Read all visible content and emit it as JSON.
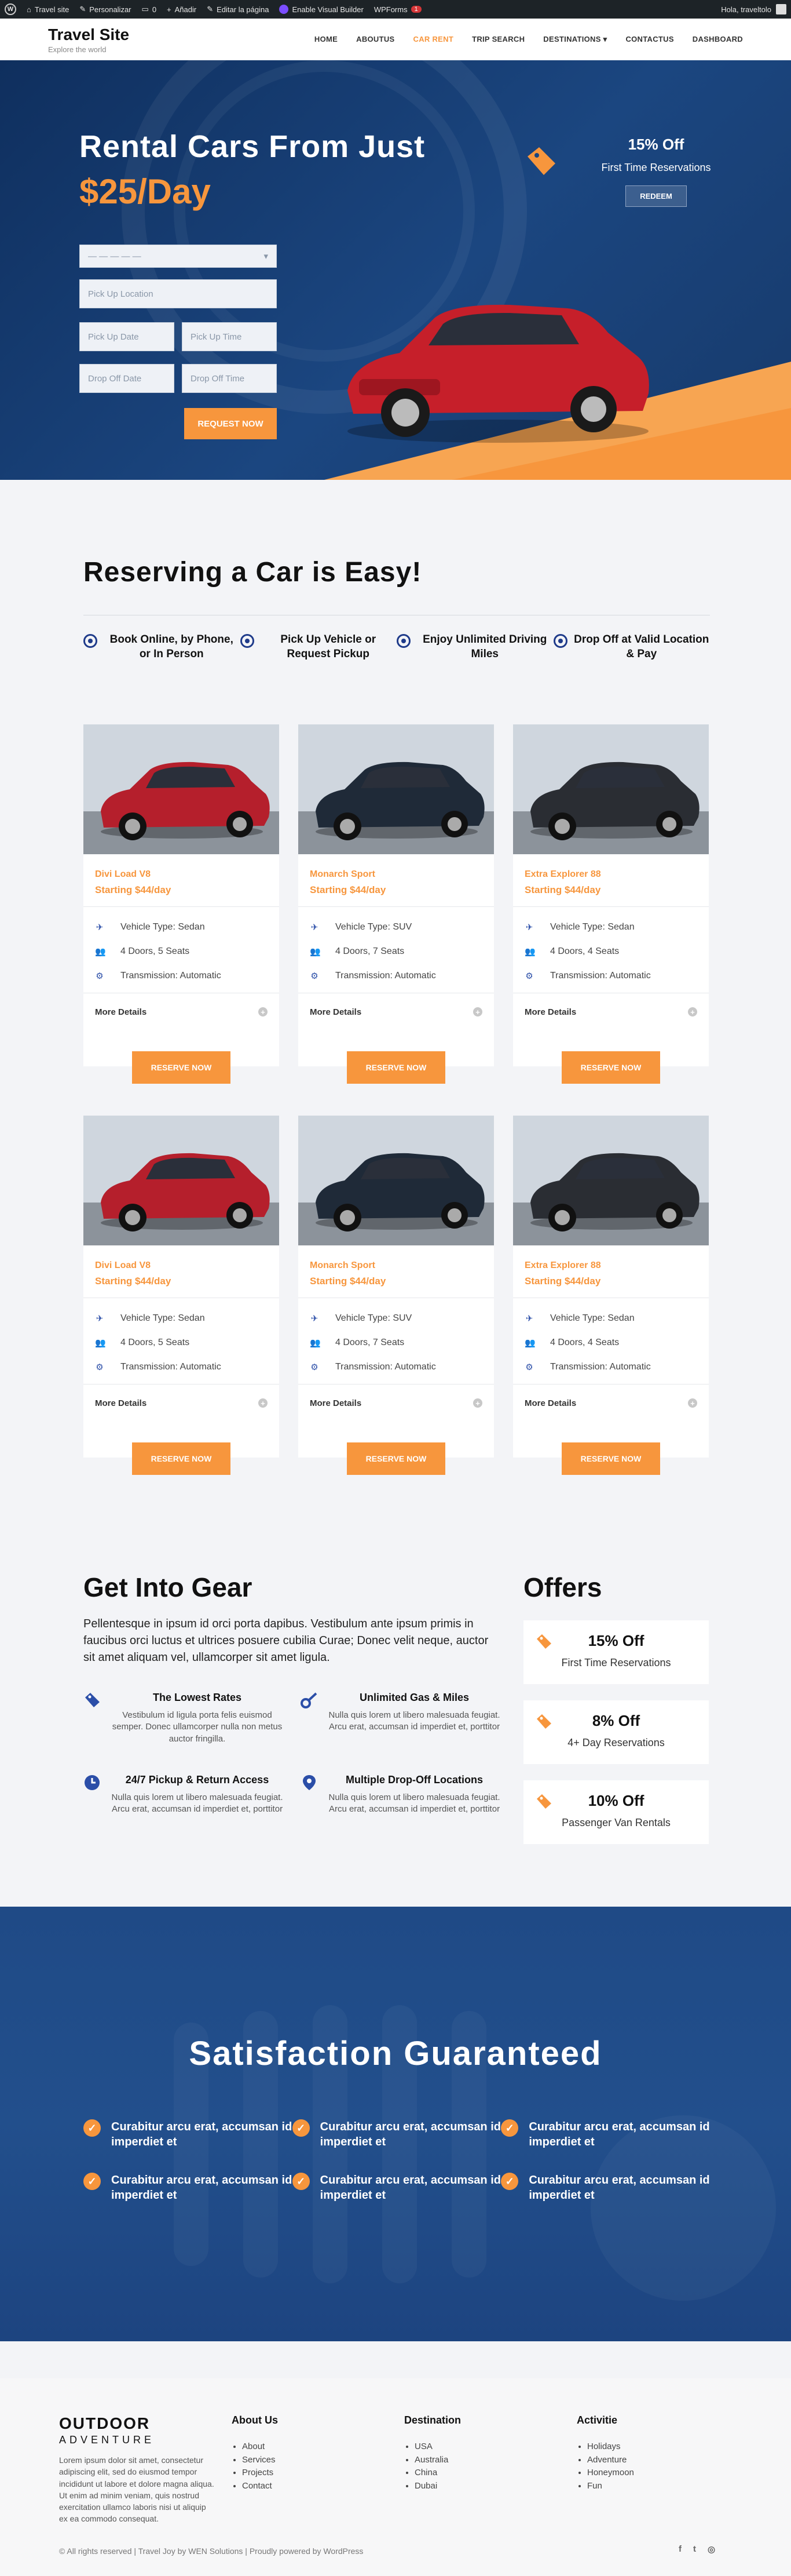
{
  "adminbar": {
    "items": [
      "Travel site",
      "Personalizar",
      "0",
      "Añadir",
      "Editar la página",
      "Enable Visual Builder",
      "WPForms",
      "1"
    ],
    "greeting": "Hola, traveltolo"
  },
  "header": {
    "site_title": "Travel Site",
    "tagline": "Explore the world",
    "nav": [
      "HOME",
      "ABOUTUS",
      "CAR RENT",
      "TRIP SEARCH",
      "DESTINATIONS",
      "CONTACTUS",
      "DASHBOARD"
    ],
    "active_nav": "CAR RENT"
  },
  "hero": {
    "title": "Rental Cars From Just",
    "price": "$25/Day",
    "select_placeholder": "— — — — —",
    "pickup_location": "Pick Up Location",
    "pickup_date": "Pick Up Date",
    "pickup_time": "Pick Up Time",
    "dropoff_date": "Drop Off Date",
    "dropoff_time": "Drop Off Time",
    "request_button": "REQUEST NOW",
    "offer_percent": "15% Off",
    "offer_text": "First Time Reservations",
    "redeem_button": "REDEEM"
  },
  "steps": {
    "title": "Reserving a Car is Easy!",
    "items": [
      "Book Online, by Phone, or In Person",
      "Pick Up Vehicle or Request Pickup",
      "Enjoy Unlimited Driving Miles",
      "Drop Off at Valid Location & Pay"
    ]
  },
  "cars": [
    {
      "name": "Divi Load V8",
      "price": "Starting $44/day",
      "type": "Vehicle Type: Sedan",
      "doors": "4 Doors, 5 Seats",
      "trans": "Transmission: Automatic",
      "color": "#b51f2c"
    },
    {
      "name": "Monarch Sport",
      "price": "Starting $44/day",
      "type": "Vehicle Type: SUV",
      "doors": "4 Doors, 7 Seats",
      "trans": "Transmission: Automatic",
      "color": "#1f2a38"
    },
    {
      "name": "Extra Explorer 88",
      "price": "Starting $44/day",
      "type": "Vehicle Type: Sedan",
      "doors": "4 Doors, 4 Seats",
      "trans": "Transmission: Automatic",
      "color": "#2a2d33"
    }
  ],
  "car_common": {
    "more_details": "More Details",
    "reserve": "RESERVE NOW"
  },
  "gear": {
    "title": "Get Into Gear",
    "lead": "Pellentesque in ipsum id orci porta dapibus. Vestibulum ante ipsum primis in faucibus orci luctus et ultrices posuere cubilia Curae; Donec velit neque, auctor sit amet aliquam vel, ullamcorper sit amet ligula.",
    "features": [
      {
        "title": "The Lowest Rates",
        "text": "Vestibulum id ligula porta felis euismod semper. Donec ullamcorper nulla non metus auctor fringilla."
      },
      {
        "title": "Unlimited Gas & Miles",
        "text": "Nulla quis lorem ut libero malesuada feugiat. Arcu erat, accumsan id imperdiet et, porttitor"
      },
      {
        "title": "24/7 Pickup & Return Access",
        "text": "Nulla quis lorem ut libero malesuada feugiat. Arcu erat, accumsan id imperdiet et, porttitor"
      },
      {
        "title": "Multiple Drop-Off Locations",
        "text": "Nulla quis lorem ut libero malesuada feugiat. Arcu erat, accumsan id imperdiet et, porttitor"
      }
    ]
  },
  "offers": {
    "title": "Offers",
    "items": [
      {
        "pct": "15% Off",
        "text": "First Time Reservations"
      },
      {
        "pct": "8% Off",
        "text": "4+ Day Reservations"
      },
      {
        "pct": "10% Off",
        "text": "Passenger Van Rentals"
      }
    ]
  },
  "satisfaction": {
    "title": "Satisfaction Guaranteed",
    "item": "Curabitur arcu erat, accumsan id imperdiet et"
  },
  "footer": {
    "logo_1": "OUTDOOR",
    "logo_2": "ADVENTURE",
    "about_text": "Lorem ipsum dolor sit amet, consectetur adipiscing elit, sed do eiusmod tempor incididunt ut labore et dolore magna aliqua. Ut enim ad minim veniam, quis nostrud exercitation ullamco laboris nisi ut aliquip ex ea commodo consequat.",
    "columns": [
      {
        "title": "About Us",
        "items": [
          "About",
          "Services",
          "Projects",
          "Contact"
        ]
      },
      {
        "title": "Destination",
        "items": [
          "USA",
          "Australia",
          "China",
          "Dubai"
        ]
      },
      {
        "title": "Activitie",
        "items": [
          "Holidays",
          "Adventure",
          "Honeymoon",
          "Fun"
        ]
      }
    ],
    "copyright": "© All rights reserved | Travel Joy by WEN Solutions | Proudly powered by WordPress",
    "social": [
      "f",
      "t",
      "◎"
    ]
  },
  "colors": {
    "accent": "#f7963d",
    "navy": "#1b4680",
    "icon_blue": "#2b4ea8"
  }
}
